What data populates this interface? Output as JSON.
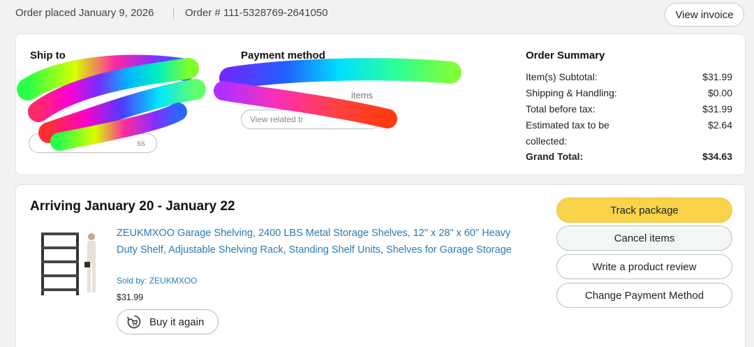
{
  "order": {
    "placed": "Order placed January 9, 2026",
    "number": "Order # 111-5328769-2641050",
    "view_invoice": "View invoice"
  },
  "ship_to": {
    "title": "Ship to",
    "change_address": "ss"
  },
  "payment": {
    "title": "Payment method",
    "items_text": "items",
    "view_related": "View related tr"
  },
  "summary": {
    "title": "Order Summary",
    "rows": [
      {
        "label": "Item(s) Subtotal:",
        "value": "$31.99"
      },
      {
        "label": "Shipping & Handling:",
        "value": "$0.00"
      },
      {
        "label": "Total before tax:",
        "value": "$31.99"
      },
      {
        "label": "Estimated tax to be collected:",
        "value": "$2.64"
      },
      {
        "label": "Grand Total:",
        "value": "$34.63"
      }
    ]
  },
  "shipment": {
    "arriving": "Arriving January 20 - January 22",
    "product_title": "ZEUKMXOO Garage Shelving, 2400 LBS Metal Storage Shelves, 12\" x 28\" x 60\" Heavy Duty Shelf, Adjustable Shelving Rack, Standing Shelf Units, Shelves for Garage Storage",
    "sold_by": "Sold by: ZEUKMXOO",
    "price": "$31.99",
    "buy_again": "Buy it again",
    "buy_again_icon": "buy-again-icon",
    "actions": {
      "track": "Track package",
      "cancel": "Cancel items",
      "review": "Write a product review",
      "change_payment": "Change Payment Method"
    }
  },
  "colors": {
    "accent_yellow": "#f9d34a",
    "link_blue": "#2b7ab5",
    "card_border": "#e3e3e3"
  }
}
